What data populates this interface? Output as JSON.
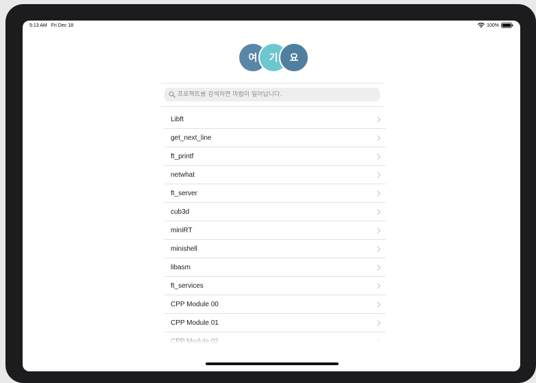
{
  "status_bar": {
    "time": "5:13 AM",
    "date": "Fri Dec 18",
    "battery": "100%"
  },
  "logo": {
    "letters": [
      "여",
      "기",
      "요"
    ],
    "colors": [
      "#5a86a8",
      "#6ec6d0",
      "#4f7f9f"
    ]
  },
  "search": {
    "placeholder": "프로젝트를 검색하면 마법이 일어납니다."
  },
  "projects": [
    {
      "label": "Libft"
    },
    {
      "label": "get_next_line"
    },
    {
      "label": "ft_printf"
    },
    {
      "label": "netwhat"
    },
    {
      "label": "ft_server"
    },
    {
      "label": "cub3d"
    },
    {
      "label": "miniRT"
    },
    {
      "label": "minishell"
    },
    {
      "label": "libasm"
    },
    {
      "label": "ft_services"
    },
    {
      "label": "CPP Module 00"
    },
    {
      "label": "CPP Module 01"
    },
    {
      "label": "CPP Module 02"
    }
  ],
  "icons": {
    "search": "search-icon",
    "chevron": "chevron-right-icon",
    "wifi": "wifi-icon",
    "battery": "battery-icon"
  }
}
